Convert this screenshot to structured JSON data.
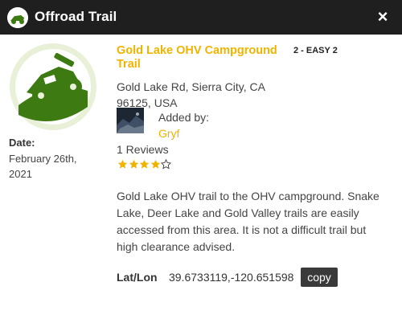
{
  "header": {
    "title": "Offroad Trail",
    "icon": "jeep-icon",
    "close_label": "×"
  },
  "trail": {
    "title": "Gold Lake OHV Campground Trail",
    "difficulty": "2 - EASY 2",
    "address": "Gold Lake Rd, Sierra City, CA 96125, USA",
    "added_by_label": "Added by:",
    "added_by_user": "Gryf",
    "reviews": "1 Reviews",
    "rating": 4,
    "rating_max": 5,
    "description": "Gold Lake OHV trail to the OHV campground. Snake Lake, Deer Lake and Gold Valley trails are easily accessed from this area. It is not a difficult trail but high clearance advised.",
    "latlon_label": "Lat/Lon",
    "latlon_value": "39.6733119,-120.651598",
    "copy_label": "copy"
  },
  "date": {
    "label": "Date:",
    "value": "February 26th, 2021"
  },
  "colors": {
    "header_bg": "#1f1f1f",
    "accent": "#f0b400",
    "logo_green": "#3d7a12",
    "logo_ring": "#e8f0d8"
  }
}
